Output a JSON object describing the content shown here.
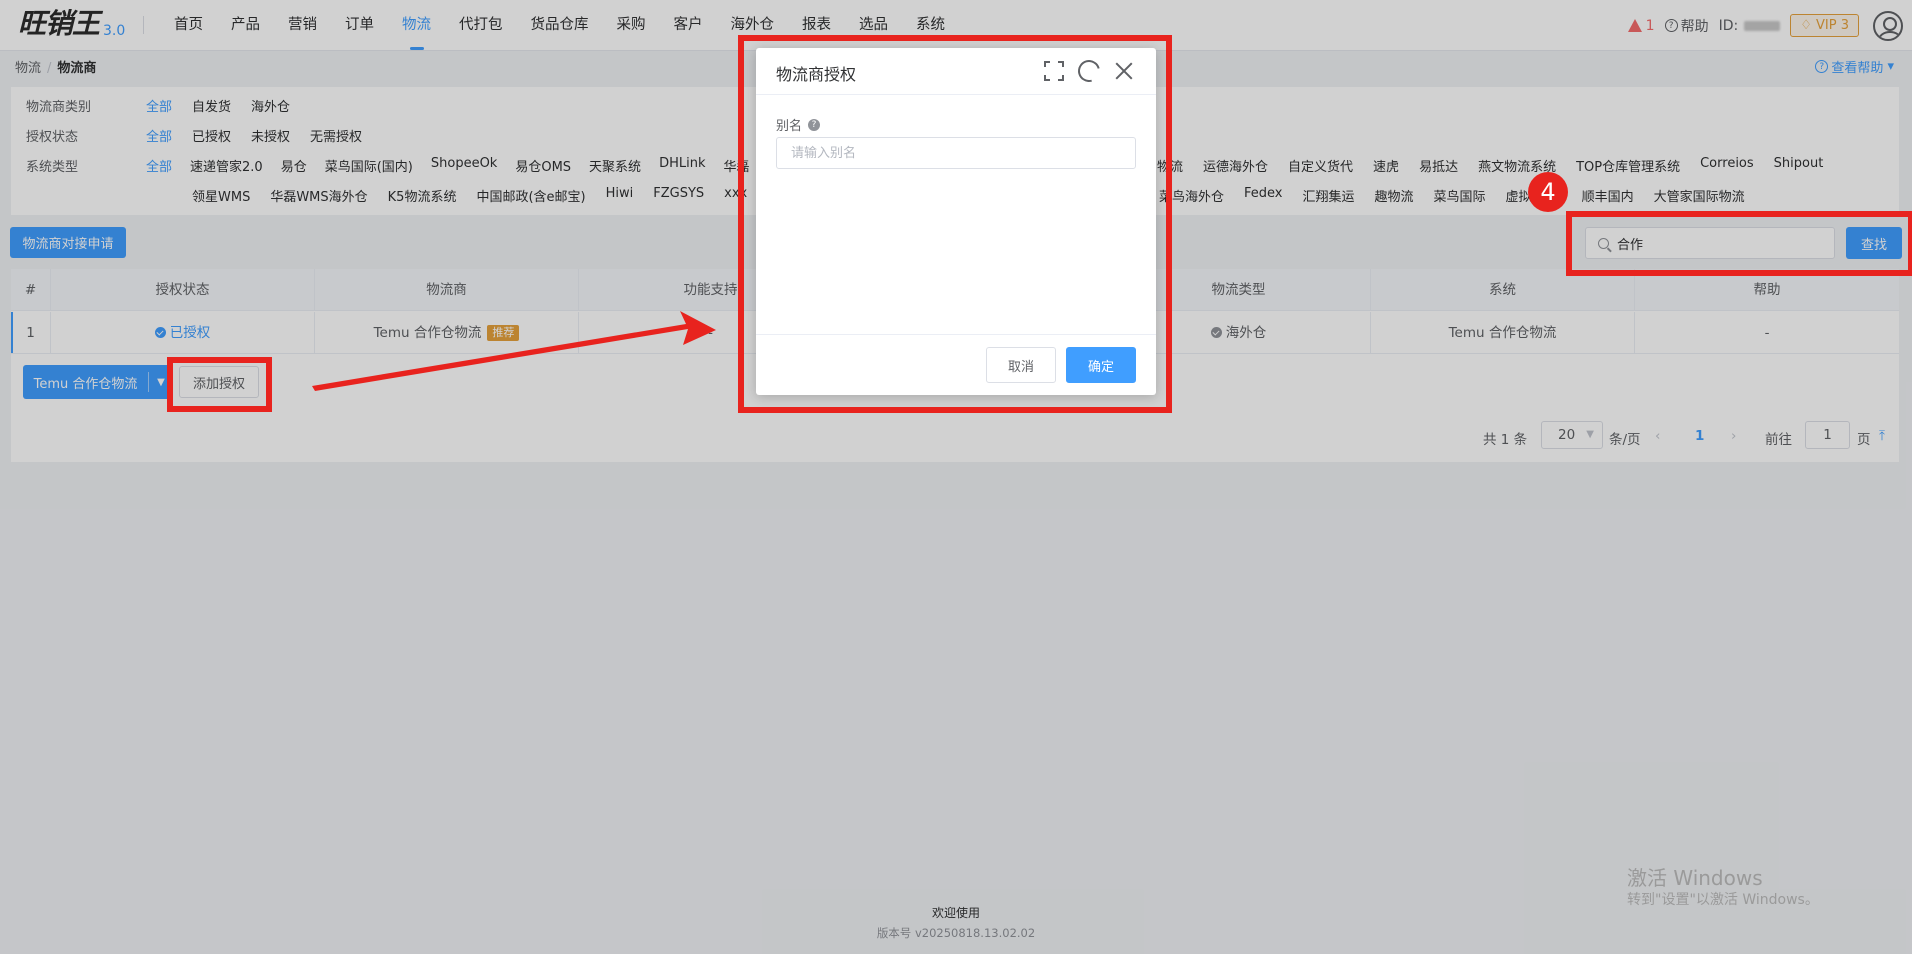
{
  "brand": {
    "logo_text": "旺销王",
    "version": "3.0"
  },
  "nav": [
    "首页",
    "产品",
    "营销",
    "订单",
    "物流",
    "代打包",
    "货品仓库",
    "采购",
    "客户",
    "海外仓",
    "报表",
    "选品",
    "系统"
  ],
  "nav_active": "物流",
  "topright": {
    "alert_count": "1",
    "help": "帮助",
    "id_label": "ID:",
    "vip": "VIP 3"
  },
  "breadcrumb": {
    "parent": "物流",
    "current": "物流商"
  },
  "view_help": "查看帮助",
  "filters": {
    "category": {
      "label": "物流商类别",
      "options": [
        "全部",
        "自发货",
        "海外仓"
      ]
    },
    "auth": {
      "label": "授权状态",
      "options": [
        "全部",
        "已授权",
        "未授权",
        "无需授权"
      ]
    },
    "system": {
      "label": "系统类型",
      "row1": [
        "全部",
        "速递管家2.0",
        "易仓",
        "菜鸟国际(国内)",
        "ShopeeOk",
        "易仓OMS",
        "天聚系统",
        "DHLink",
        "华磊"
      ],
      "row1_right": [
        "物流",
        "运德海外仓",
        "自定义货代",
        "速虎",
        "易抵达",
        "燕文物流系统",
        "TOP仓库管理系统",
        "Correios",
        "Shipout"
      ],
      "row2": [
        "领星WMS",
        "华磊WMS海外仓",
        "K5物流系统",
        "中国邮政(含e邮宝)",
        "Hiwi",
        "FZGSYS",
        "xxx"
      ],
      "row2_right": [
        "菜鸟海外仓",
        "Fedex",
        "汇翔集运",
        "趣物流",
        "菜鸟国际",
        "虚拟",
        "顺丰国内",
        "大管家国际物流"
      ]
    }
  },
  "apply_button": "物流商对接申请",
  "search": {
    "value": "合作",
    "button": "查找"
  },
  "table": {
    "headers": [
      "#",
      "授权状态",
      "物流商",
      "功能支持",
      "物流类型",
      "系统",
      "帮助"
    ],
    "rows": [
      {
        "index": "1",
        "status": "已授权",
        "provider": "Temu 合作仓物流",
        "badge": "推荐",
        "feature": "-",
        "type": "海外仓",
        "system": "Temu 合作仓物流",
        "help": "-"
      }
    ]
  },
  "row_actions": {
    "split_label": "Temu 合作仓物流",
    "add_auth": "添加授权"
  },
  "pagination": {
    "total": "共 1 条",
    "page_size": "20",
    "per_page": "条/页",
    "current": "1",
    "goto": "前往",
    "goto_value": "1",
    "page_unit": "页"
  },
  "modal": {
    "title": "物流商授权",
    "alias_label": "别名",
    "alias_placeholder": "请输入别名",
    "cancel": "取消",
    "confirm": "确定"
  },
  "step_number": "4",
  "footer": {
    "welcome": "欢迎使用",
    "version": "版本号 v20250818.13.02.02"
  },
  "watermark": {
    "line1": "激活 Windows",
    "line2": "转到\"设置\"以激活 Windows。"
  },
  "colors": {
    "primary": "#409eff",
    "annotation": "#e8231e",
    "warning": "#e6a23c"
  }
}
